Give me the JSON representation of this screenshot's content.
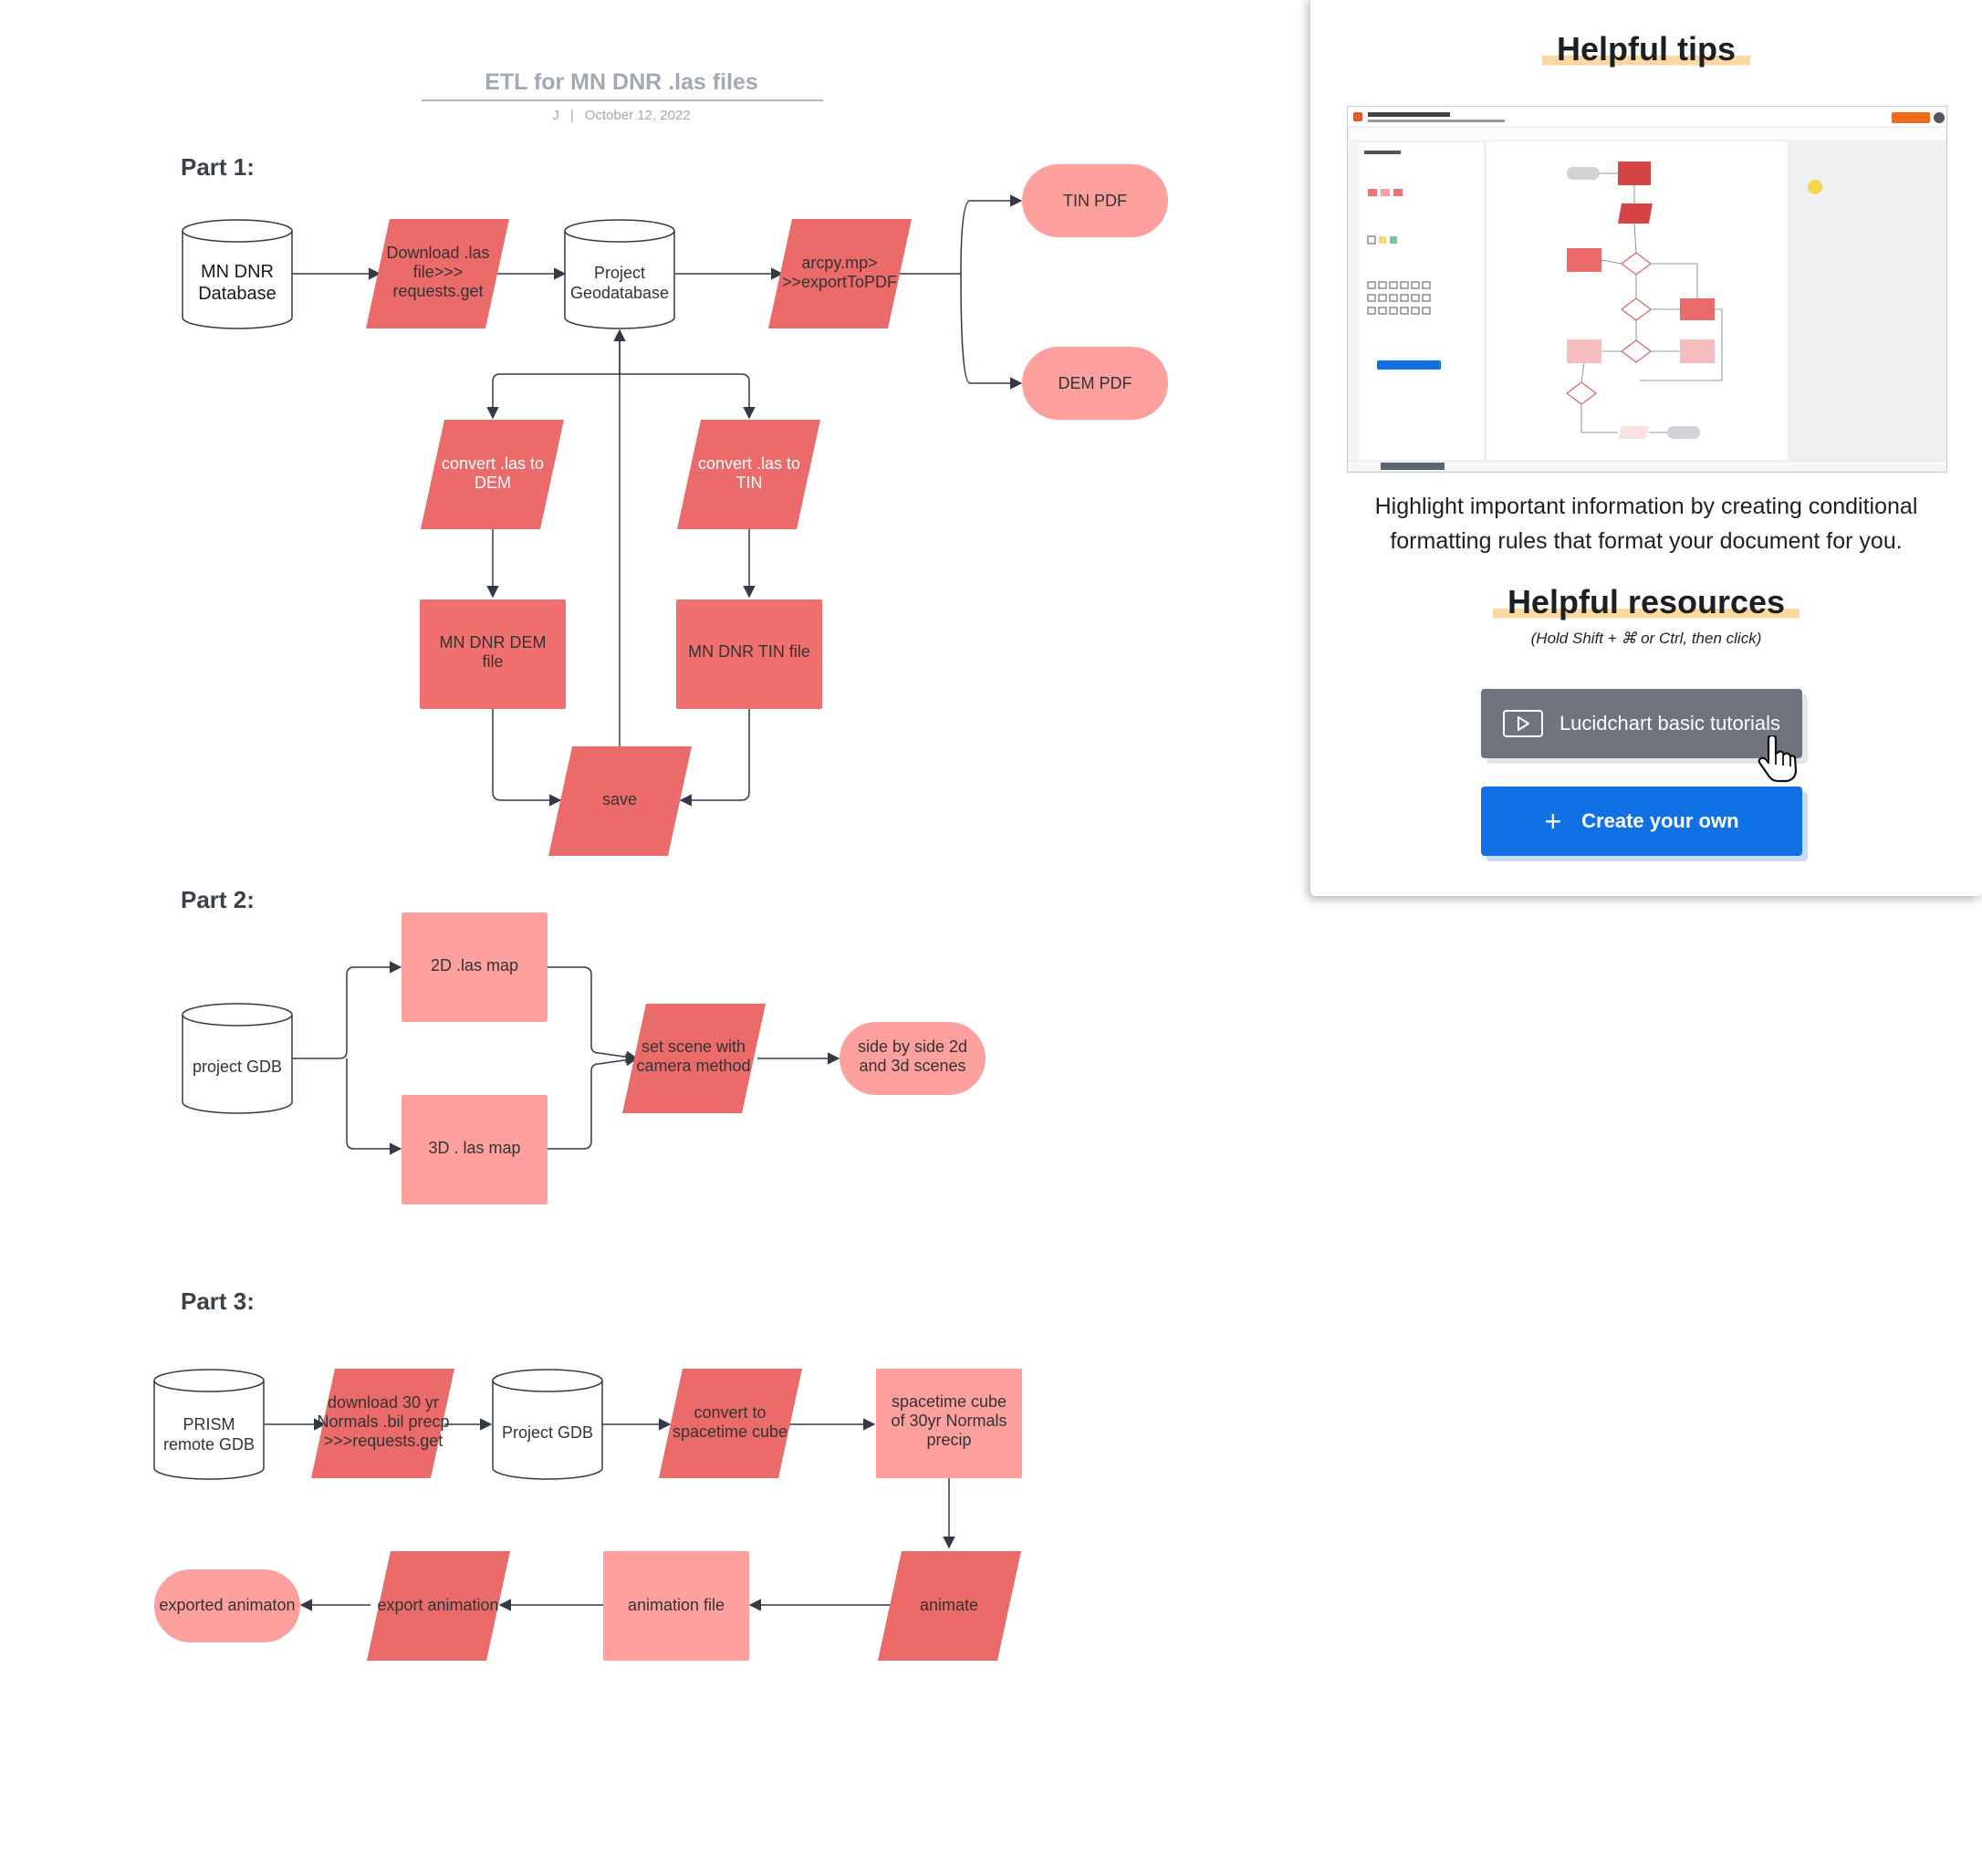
{
  "document": {
    "title": "ETL for MN DNR .las files",
    "author": "J",
    "separator": "|",
    "date": "October 12, 2022"
  },
  "diagram": {
    "parts": {
      "part1": "Part 1:",
      "part2": "Part 2:",
      "part3": "Part 3:"
    },
    "nodes": {
      "mn_dnr_db": [
        "MN DNR",
        "Database"
      ],
      "download_las": [
        "Download .las",
        "file>>>",
        "requests.get"
      ],
      "project_geodb": [
        "Project",
        "Geodatabase"
      ],
      "arcpy_export": [
        "arcpy.mp>",
        ">>exportToPDF"
      ],
      "tin_pdf": [
        "TIN PDF"
      ],
      "dem_pdf": [
        "DEM PDF"
      ],
      "convert_dem": [
        "convert .las to",
        "DEM"
      ],
      "convert_tin": [
        "convert .las to",
        "TIN"
      ],
      "dem_file": [
        "MN DNR DEM",
        "file"
      ],
      "tin_file": [
        "MN DNR TIN file"
      ],
      "save": [
        "save"
      ],
      "project_gdb_2": [
        "project GDB"
      ],
      "map_2d": [
        "2D .las map"
      ],
      "map_3d": [
        "3D . las map"
      ],
      "set_scene": [
        "set scene with",
        "camera method"
      ],
      "side_by_side": [
        "side by side 2d",
        "and 3d scenes"
      ],
      "prism_gdb": [
        "PRISM",
        "remote GDB"
      ],
      "download_normals": [
        "download 30 yr",
        "Normals .bil precp",
        ">>>requests.get"
      ],
      "project_gdb_3": [
        "Project GDB"
      ],
      "convert_cube": [
        "convert to",
        "spacetime cube"
      ],
      "spacetime_cube": [
        "spacetime cube",
        "of 30yr Normals",
        "precip"
      ],
      "animate": [
        "animate"
      ],
      "animation_file": [
        "animation file"
      ],
      "export_animation": [
        "export animation"
      ],
      "exported_animation": [
        "exported animaton"
      ]
    }
  },
  "tips": {
    "heading": "Helpful tips",
    "body": "Highlight important information by creating conditional formatting rules that format your document for you.",
    "resources_heading": "Helpful resources",
    "hint": "(Hold Shift + ⌘ or Ctrl, then click)",
    "tutorials_label": "Lucidchart basic tutorials",
    "create_label": "Create your own"
  },
  "colors": {
    "process_dark": "#eb6b6b",
    "process_light": "#fda09e",
    "terminal": "#fda09e",
    "primary_button": "#1071e5",
    "secondary_button": "#6e737e",
    "highlight": "#fcd7a2"
  },
  "icons": [
    "play-icon",
    "plus-icon",
    "hand-cursor-icon"
  ]
}
